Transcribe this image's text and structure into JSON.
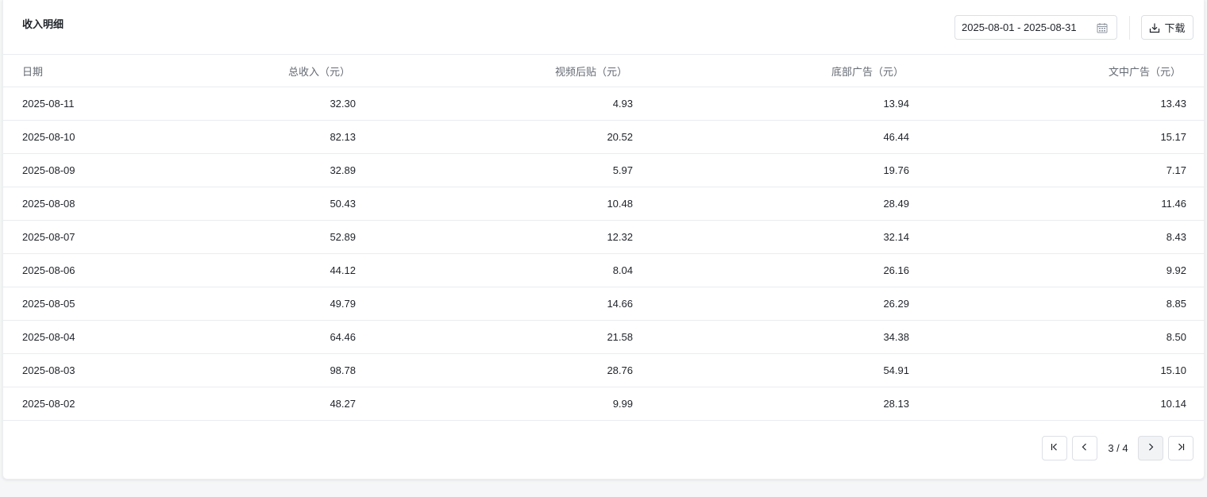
{
  "header": {
    "title": "收入明细",
    "date_range": "2025-08-01 - 2025-08-31",
    "download_label": "下载"
  },
  "table": {
    "columns": [
      "日期",
      "总收入（元）",
      "视频后贴（元）",
      "底部广告（元）",
      "文中广告（元）"
    ],
    "rows": [
      [
        "2025-08-11",
        "32.30",
        "4.93",
        "13.94",
        "13.43"
      ],
      [
        "2025-08-10",
        "82.13",
        "20.52",
        "46.44",
        "15.17"
      ],
      [
        "2025-08-09",
        "32.89",
        "5.97",
        "19.76",
        "7.17"
      ],
      [
        "2025-08-08",
        "50.43",
        "10.48",
        "28.49",
        "11.46"
      ],
      [
        "2025-08-07",
        "52.89",
        "12.32",
        "32.14",
        "8.43"
      ],
      [
        "2025-08-06",
        "44.12",
        "8.04",
        "26.16",
        "9.92"
      ],
      [
        "2025-08-05",
        "49.79",
        "14.66",
        "26.29",
        "8.85"
      ],
      [
        "2025-08-04",
        "64.46",
        "21.58",
        "34.38",
        "8.50"
      ],
      [
        "2025-08-03",
        "98.78",
        "28.76",
        "54.91",
        "15.10"
      ],
      [
        "2025-08-02",
        "48.27",
        "9.99",
        "28.13",
        "10.14"
      ]
    ]
  },
  "pagination": {
    "page_info": "3 / 4",
    "icons": [
      "first-page-icon",
      "prev-page-icon",
      "next-page-icon",
      "last-page-icon"
    ]
  },
  "icons": {
    "calendar": "calendar-icon",
    "download": "download-icon"
  }
}
